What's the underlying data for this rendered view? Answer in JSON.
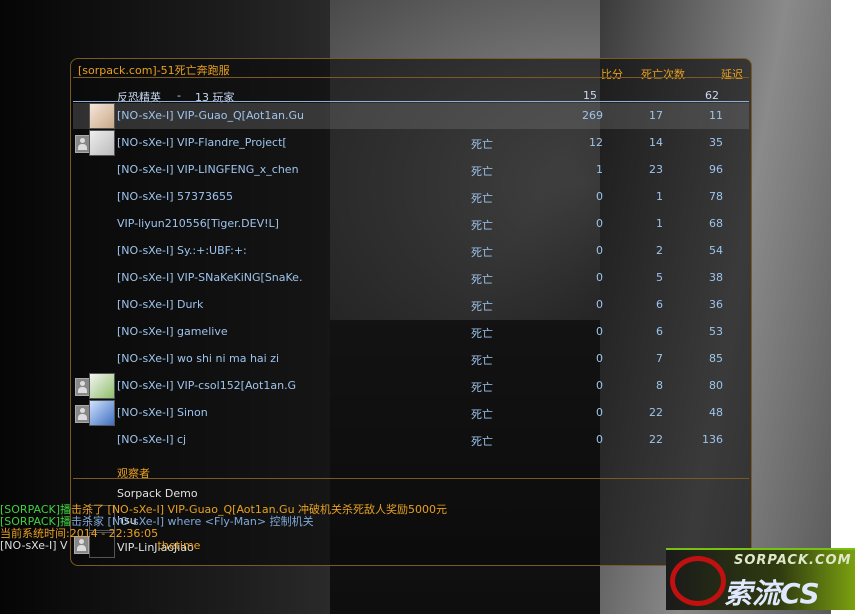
{
  "board": {
    "title": "[sorpack.com]-51死亡奔跑服",
    "col_score": "比分",
    "col_deaths": "死亡次数",
    "col_ping": "延迟",
    "team": {
      "name": "反恐精英",
      "sep": "-",
      "players": "13 玩家",
      "score": "15",
      "ping": "62"
    },
    "rows": [
      {
        "name": "[NO-sXe-I] VIP-Guao_Q[Aot1an.Gu",
        "status": "",
        "score": "269",
        "deaths": "17",
        "ping": "11",
        "avatar": "girl-avatar",
        "self": true
      },
      {
        "name": "[NO-sXe-I] VIP-Flandre_Project[",
        "status": "死亡",
        "score": "12",
        "deaths": "14",
        "ping": "35",
        "avatar": "sketch-avatar",
        "friend": true
      },
      {
        "name": "[NO-sXe-I] VIP-LINGFENG_x_chen",
        "status": "死亡",
        "score": "1",
        "deaths": "23",
        "ping": "96"
      },
      {
        "name": "[NO-sXe-I] 57373655",
        "status": "死亡",
        "score": "0",
        "deaths": "1",
        "ping": "78"
      },
      {
        "name": "VIP-liyun210556[Tiger.DEV!L]",
        "status": "死亡",
        "score": "0",
        "deaths": "1",
        "ping": "68"
      },
      {
        "name": "[NO-sXe-I] Sy.:+:UBF:+:",
        "status": "死亡",
        "score": "0",
        "deaths": "2",
        "ping": "54"
      },
      {
        "name": "[NO-sXe-I] VIP-SNaKeKiNG[SnaKe.",
        "status": "死亡",
        "score": "0",
        "deaths": "5",
        "ping": "38"
      },
      {
        "name": "[NO-sXe-I] Durk",
        "status": "死亡",
        "score": "0",
        "deaths": "6",
        "ping": "36"
      },
      {
        "name": "[NO-sXe-I] gamelive",
        "status": "死亡",
        "score": "0",
        "deaths": "6",
        "ping": "53"
      },
      {
        "name": "[NO-sXe-I] wo shi ni ma hai zi",
        "status": "死亡",
        "score": "0",
        "deaths": "7",
        "ping": "85"
      },
      {
        "name": "[NO-sXe-I] VIP-csol152[Aot1an.G",
        "status": "死亡",
        "score": "0",
        "deaths": "8",
        "ping": "80",
        "avatar": "cartoon-avatar",
        "friend": true
      },
      {
        "name": "[NO-sXe-I] Sinon",
        "status": "死亡",
        "score": "0",
        "deaths": "22",
        "ping": "48",
        "avatar": "anime-avatar",
        "friend": true
      },
      {
        "name": "[NO-sXe-I] cj",
        "status": "死亡",
        "score": "0",
        "deaths": "22",
        "ping": "136"
      }
    ],
    "spectators_title": "观察者",
    "spectators": [
      "Sorpack Demo",
      "hsu",
      "VIP-LinJiaoJiao"
    ]
  },
  "chat": [
    {
      "prefix": "[SORPACK]播",
      "text": "击杀了 [NO-sXe-I] VIP-Guao_Q[Aot1an.Gu 冲破机关杀死敌人奖励5000元"
    },
    {
      "prefix": "[SORPACK]播",
      "text": "击杀家 [NO-sXe-I] where <Fly-Man> 控制机关"
    },
    {
      "prefix": "当前系统时间:",
      "text": "2014 - 22:36:05"
    },
    {
      "prefix": "[NO-sXe-I] V",
      "text": "thetime"
    }
  ],
  "logo": {
    "line1": "SORPACK.COM",
    "line2": "索流CS"
  },
  "colors": {
    "accent": "#e8a020",
    "player_text": "#9ec4ee",
    "chat_green": "#3fd23f"
  }
}
